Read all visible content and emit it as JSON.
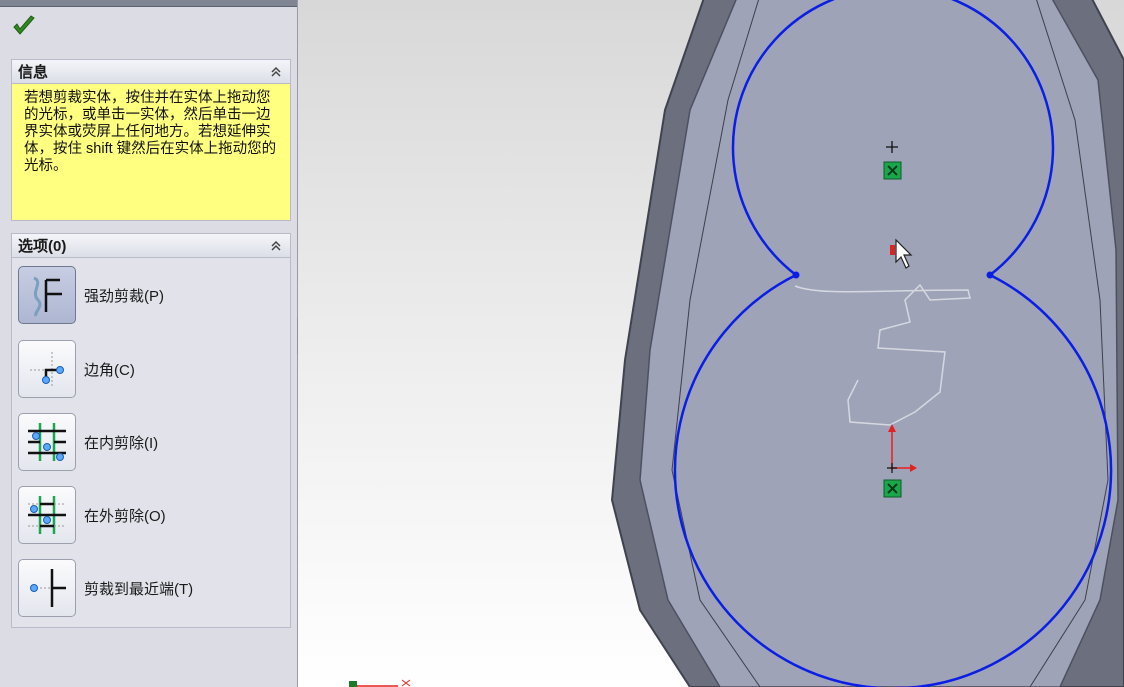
{
  "info_section": {
    "title": "信息",
    "message": "若想剪裁实体，按住并在实体上拖动您的光标，或单击一实体，然后单击一边界实体或荧屏上任何地方。若想延伸实体，按住 shift 键然后在实体上拖动您的光标。"
  },
  "options_section": {
    "title": "选项(0)",
    "items": [
      {
        "label": "强劲剪裁(P)",
        "icon": "power-trim-icon",
        "selected": true
      },
      {
        "label": "边角(C)",
        "icon": "corner-trim-icon",
        "selected": false
      },
      {
        "label": "在内剪除(I)",
        "icon": "trim-inside-icon",
        "selected": false
      },
      {
        "label": "在外剪除(O)",
        "icon": "trim-outside-icon",
        "selected": false
      },
      {
        "label": "剪裁到最近端(T)",
        "icon": "trim-to-closest-icon",
        "selected": false
      }
    ]
  },
  "colors": {
    "sketch_line": "#0a1ee6",
    "part_face": "#9ea3b8",
    "part_wall": "#6b6f7e",
    "info_bg": "#ffff80",
    "confirm": "#2f8a1f"
  }
}
